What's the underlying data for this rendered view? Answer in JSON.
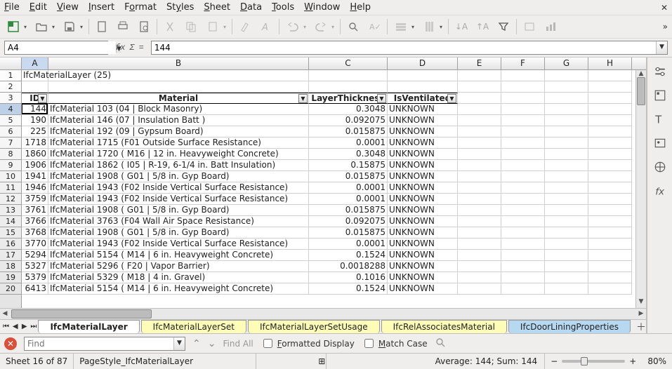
{
  "menu": {
    "file": "File",
    "edit": "Edit",
    "view": "View",
    "insert": "Insert",
    "format": "Format",
    "styles": "Styles",
    "sheet": "Sheet",
    "data": "Data",
    "tools": "Tools",
    "window": "Window",
    "help": "Help"
  },
  "cellRef": "A4",
  "formula": "144",
  "columns": [
    "A",
    "B",
    "C",
    "D",
    "E",
    "F",
    "G",
    "H"
  ],
  "row1_title": "IfcMaterialLayer  (25)",
  "headers": {
    "id": "ID",
    "material": "Material",
    "thickness": "LayerThickness",
    "vent": "IsVentilated"
  },
  "rows": [
    {
      "n": 4,
      "id": "144",
      "mat": "IfcMaterial 103  (04 | Block Masonry)",
      "th": "0.3048",
      "v": "UNKNOWN"
    },
    {
      "n": 5,
      "id": "190",
      "mat": "IfcMaterial 146  (07 | Insulation Batt )",
      "th": "0.092075",
      "v": "UNKNOWN"
    },
    {
      "n": 6,
      "id": "225",
      "mat": "IfcMaterial 192  (09 | Gypsum Board)",
      "th": "0.015875",
      "v": "UNKNOWN"
    },
    {
      "n": 7,
      "id": "1718",
      "mat": "IfcMaterial 1715  (F01 Outside Surface Resistance)",
      "th": "0.0001",
      "v": "UNKNOWN"
    },
    {
      "n": 8,
      "id": "1860",
      "mat": "IfcMaterial 1720  ( M16 | 12 in. Heavyweight Concrete)",
      "th": "0.3048",
      "v": "UNKNOWN"
    },
    {
      "n": 9,
      "id": "1906",
      "mat": "IfcMaterial 1862  ( I05 | R-19, 6-1/4 in. Batt Insulation)",
      "th": "0.15875",
      "v": "UNKNOWN"
    },
    {
      "n": 10,
      "id": "1941",
      "mat": "IfcMaterial 1908  ( G01 | 5/8 in. Gyp Board)",
      "th": "0.015875",
      "v": "UNKNOWN"
    },
    {
      "n": 11,
      "id": "1946",
      "mat": "IfcMaterial 1943  (F02 Inside Vertical Surface Resistance)",
      "th": "0.0001",
      "v": "UNKNOWN"
    },
    {
      "n": 12,
      "id": "3759",
      "mat": "IfcMaterial 1943  (F02 Inside Vertical Surface Resistance)",
      "th": "0.0001",
      "v": "UNKNOWN"
    },
    {
      "n": 13,
      "id": "3761",
      "mat": "IfcMaterial 1908  ( G01 | 5/8 in. Gyp Board)",
      "th": "0.015875",
      "v": "UNKNOWN"
    },
    {
      "n": 14,
      "id": "3766",
      "mat": "IfcMaterial 3763  (F04 Wall Air Space Resistance)",
      "th": "0.092075",
      "v": "UNKNOWN"
    },
    {
      "n": 15,
      "id": "3768",
      "mat": "IfcMaterial 1908  ( G01 | 5/8 in. Gyp Board)",
      "th": "0.015875",
      "v": "UNKNOWN"
    },
    {
      "n": 16,
      "id": "3770",
      "mat": "IfcMaterial 1943  (F02 Inside Vertical Surface Resistance)",
      "th": "0.0001",
      "v": "UNKNOWN"
    },
    {
      "n": 17,
      "id": "5294",
      "mat": "IfcMaterial 5154  ( M14 | 6 in. Heavyweight Concrete)",
      "th": "0.1524",
      "v": "UNKNOWN"
    },
    {
      "n": 18,
      "id": "5327",
      "mat": "IfcMaterial 5296  ( F20 | Vapor Barrier)",
      "th": "0.0018288",
      "v": "UNKNOWN"
    },
    {
      "n": 19,
      "id": "5379",
      "mat": "IfcMaterial 5329  ( M18 | 4 in. Gravel)",
      "th": "0.1016",
      "v": "UNKNOWN"
    },
    {
      "n": 20,
      "id": "6413",
      "mat": "IfcMaterial 5154  ( M14 | 6 in. Heavyweight Concrete)",
      "th": "0.1524",
      "v": "UNKNOWN"
    }
  ],
  "tabs": {
    "t1": "IfcMaterialLayer",
    "t2": "IfcMaterialLayerSet",
    "t3": "IfcMaterialLayerSetUsage",
    "t4": "IfcRelAssociatesMaterial",
    "t5": "IfcDoorLiningProperties"
  },
  "find": {
    "placeholder": "Find",
    "findAll": "Find All",
    "formatted": "Formatted Display",
    "matchCase": "Match Case"
  },
  "status": {
    "sheet": "Sheet 16 of 87",
    "pageStyle": "PageStyle_IfcMaterialLayer",
    "summary": "Average: 144; Sum: 144",
    "zoom": "80%"
  }
}
